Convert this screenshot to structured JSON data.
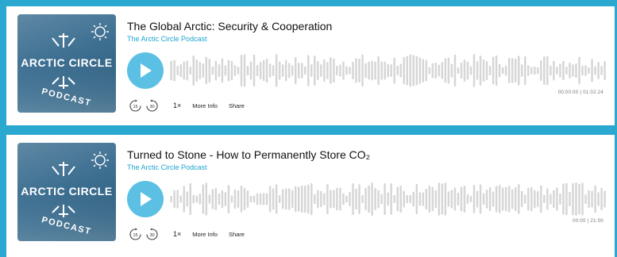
{
  "artwork": {
    "text_line1": "ARCTIC CIRCLE",
    "text_line2": "PODCAST"
  },
  "episodes": [
    {
      "title": "The Global Arctic: Security & Cooperation",
      "podcast_name": "The Arctic Circle Podcast",
      "time": "00:00:00 | 01:02:24",
      "controls": {
        "skip_back": "15",
        "skip_forward": "30",
        "speed": "1×",
        "more_info": "More Info",
        "share": "Share"
      }
    },
    {
      "title": "Turned to Stone - How to Permanently Store CO₂",
      "podcast_name": "The Arctic Circle Podcast",
      "time": "00:00 | 21:00",
      "controls": {
        "skip_back": "15",
        "skip_forward": "30",
        "speed": "1×",
        "more_info": "More Info",
        "share": "Share"
      }
    }
  ],
  "colors": {
    "background": "#2aa8cf",
    "accent": "#1ba4d4",
    "play_button": "#5bc0e4",
    "waveform": "#d6d6d6"
  },
  "icons": [
    "play-icon",
    "skip-back-15-icon",
    "skip-forward-30-icon",
    "sun-icon",
    "compass-icon"
  ]
}
